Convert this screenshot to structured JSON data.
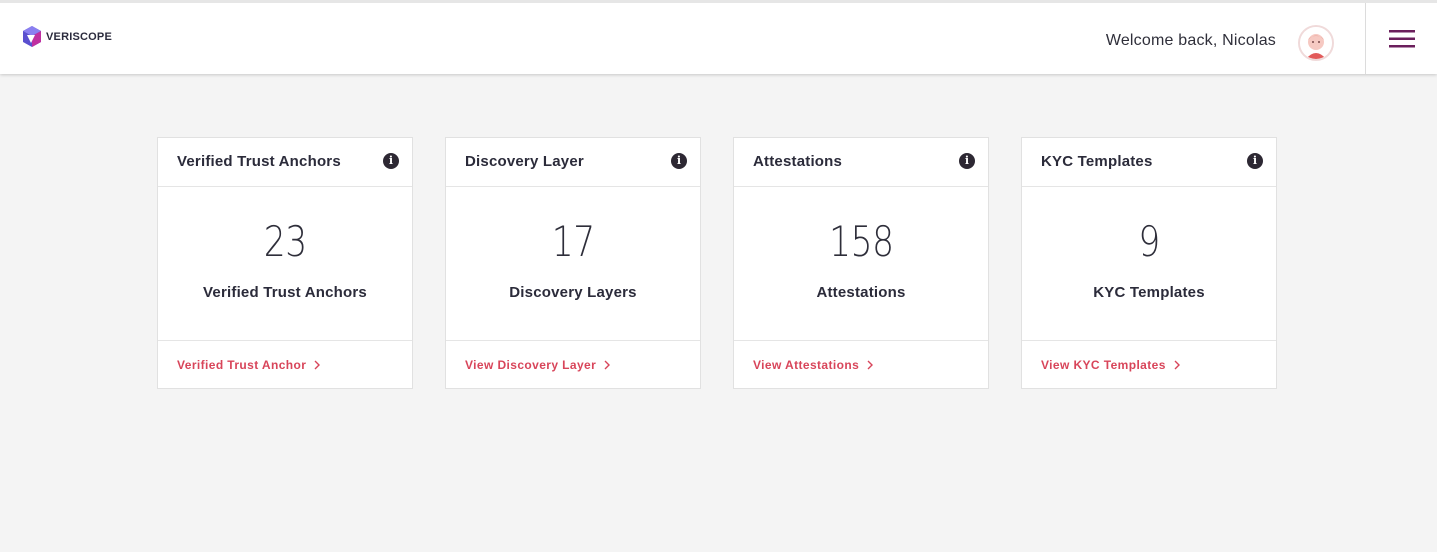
{
  "header": {
    "brand": "VERISCOPE",
    "welcome": "Welcome back, Nicolas",
    "avatar_icon": "avatar-icon",
    "menu_icon": "hamburger-menu-icon",
    "accent_color": "#6b1f5c"
  },
  "cards": [
    {
      "title": "Verified Trust Anchors",
      "count": "23",
      "label": "Verified Trust Anchors",
      "link": "Verified Trust Anchor",
      "info_icon": "i"
    },
    {
      "title": "Discovery Layer",
      "count": "17",
      "label": "Discovery Layers",
      "link": "View Discovery Layer",
      "info_icon": "i"
    },
    {
      "title": "Attestations",
      "count": "158",
      "label": "Attestations",
      "link": "View Attestations",
      "info_icon": "i"
    },
    {
      "title": "KYC Templates",
      "count": "9",
      "label": "KYC Templates",
      "link": "View KYC Templates",
      "info_icon": "i"
    }
  ],
  "colors": {
    "link": "#d8455a",
    "background": "#f4f4f4",
    "card": "#ffffff"
  }
}
